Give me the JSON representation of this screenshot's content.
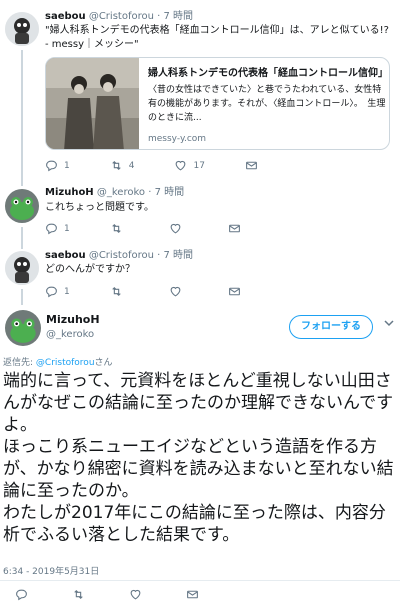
{
  "tweets": [
    {
      "name": "saebou",
      "handle": "@Cristoforou",
      "sep": "·",
      "time": "7 時間",
      "text": "\"婦人科系トンデモの代表格「経血コントロール信仰」は、アレと似ている!? - messy｜メッシー\"",
      "card": {
        "title": "婦人科系トンデモの代表格「経血コントロール信仰」...",
        "description": "〈昔の女性はできていた〉と巷でうたわれている、女性特有の機能があります。それが、〈経血コントロール〉。　生理のときに流...",
        "domain": "messy-y.com"
      },
      "actions": {
        "replies": "1",
        "retweets": "4",
        "likes": "17"
      }
    },
    {
      "name": "MizuhoH",
      "handle": "@_keroko",
      "sep": "·",
      "time": "7 時間",
      "text": "これちょっと問題です。",
      "actions": {
        "replies": "1",
        "retweets": "",
        "likes": ""
      }
    },
    {
      "name": "saebou",
      "handle": "@Cristoforou",
      "sep": "·",
      "time": "7 時間",
      "text": "どのへんがですか？",
      "actions": {
        "replies": "1",
        "retweets": "",
        "likes": ""
      }
    }
  ],
  "main": {
    "name": "MizuhoH",
    "handle": "@_keroko",
    "follow_label": "フォローする",
    "reply_prefix": "返信先:",
    "reply_handle": "@Cristoforou",
    "reply_suffix": "さん",
    "text": "端的に言って、元資料をほとんど重視しない山田さんがなぜこの結論に至ったのか理解できないんですよ。\nほっこり系ニューエイジなどという造語を作る方が、かなり綿密に資料を読み込まないと至れない結論に至ったのか。\nわたしが2017年にこの結論に至った際は、内容分析でふるい落とした結果です。",
    "datetime": "6:34 - 2019年5月31日"
  },
  "icons": {
    "reply": "reply-icon",
    "retweet": "retweet-icon",
    "like": "heart-icon",
    "dm": "envelope-icon",
    "chevron": "chevron-down-icon"
  },
  "colors": {
    "accent": "#1da1f2",
    "muted": "#657786",
    "divider": "#e6ecf0",
    "thread_line": "#ccd6dd"
  }
}
